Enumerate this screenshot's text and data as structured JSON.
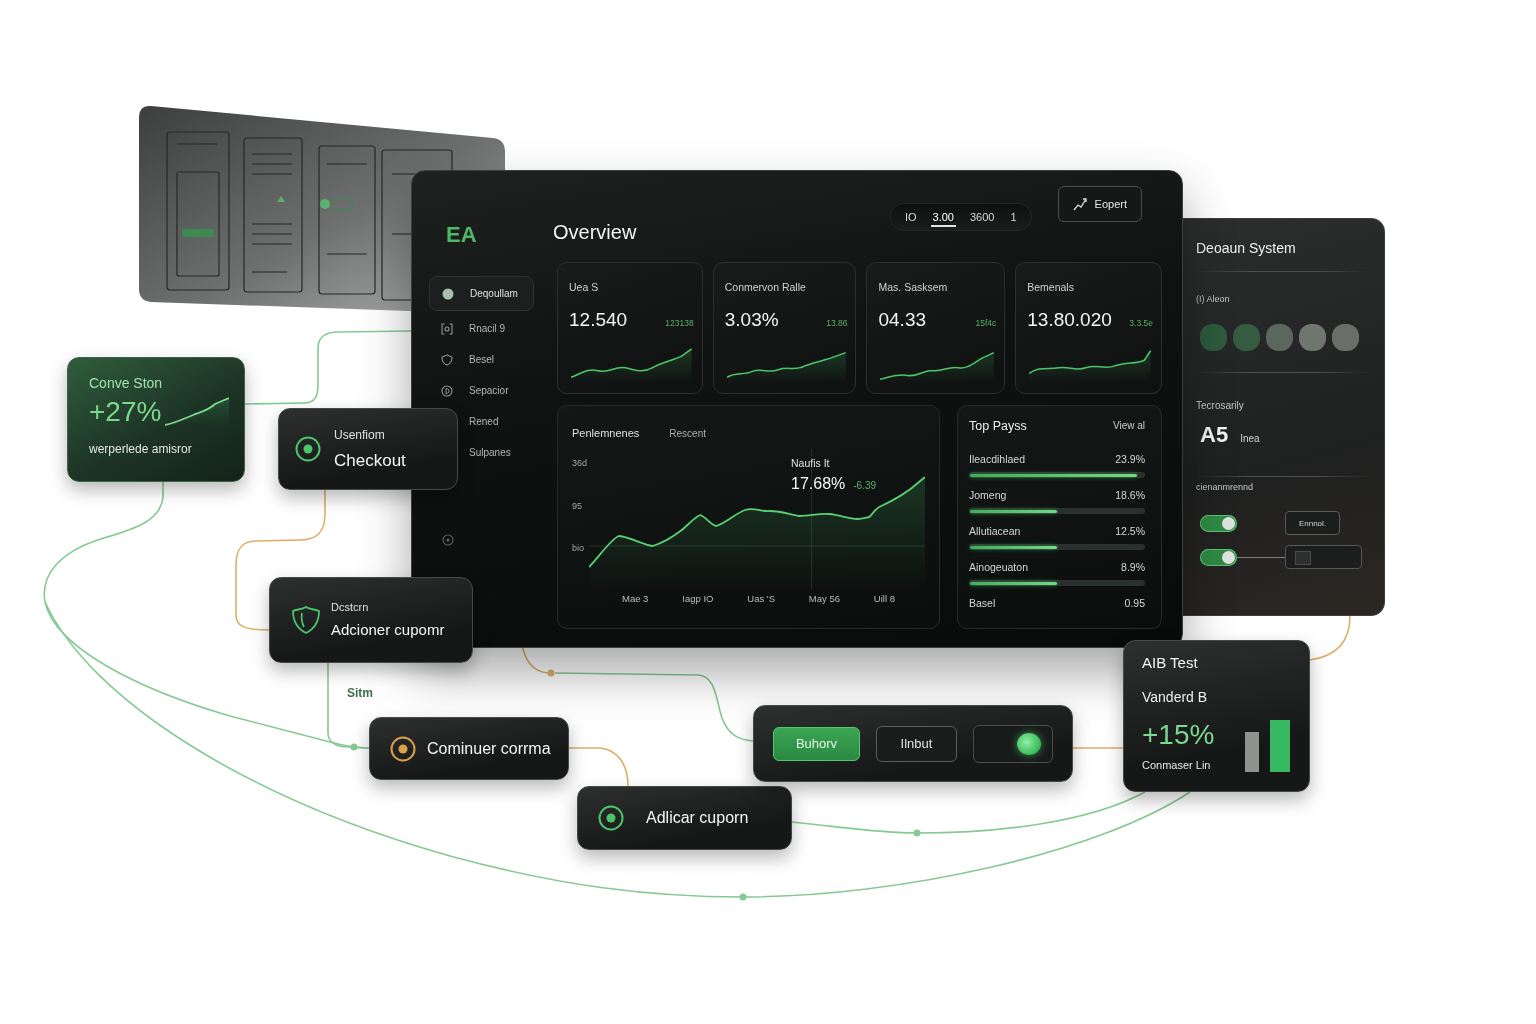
{
  "dashboard": {
    "logo": "EA",
    "title": "Overview",
    "range_tabs": [
      {
        "label": "IO",
        "selected": false
      },
      {
        "label": "3.00",
        "selected": true
      },
      {
        "label": "3600",
        "selected": false
      },
      {
        "label": "1",
        "selected": false
      }
    ],
    "export_button": "Eopert",
    "sidebar": {
      "items": [
        {
          "label": "Deqoullam",
          "selected": true
        },
        {
          "label": "Rnacil 9",
          "selected": false
        },
        {
          "label": "Besel",
          "selected": false
        },
        {
          "label": "Sepacior",
          "selected": false
        },
        {
          "label": "Rened",
          "selected": false
        },
        {
          "label": "Sulpanes",
          "selected": false
        }
      ]
    },
    "kpi_cards": [
      {
        "label": "Uea S",
        "value": "12.540",
        "change": "123138"
      },
      {
        "label": "Conmervon Ralle",
        "value": "3.03%",
        "change": "13.86"
      },
      {
        "label": "Mas. Sasksem",
        "value": "04.33",
        "change": "15f4c"
      },
      {
        "label": "Bemenals",
        "value": "13.80.020",
        "change": "3.3.5e"
      }
    ],
    "performance": {
      "title": "Penlemnenes",
      "tab": "Rescent",
      "y_labels": [
        "36d",
        "95",
        "bio"
      ],
      "tooltip": {
        "label": "Naufis It",
        "value": "17.68%",
        "change": "-6.39"
      },
      "x_labels": [
        "Mae 3",
        "Iagp IO",
        "Uas 'S",
        "May 56",
        "Uill 8"
      ]
    },
    "top_pages": {
      "title": "Top Payss",
      "link": "View al",
      "rows": [
        {
          "name": "Ileacdihlaed",
          "value": "23.9%",
          "level": 0.96
        },
        {
          "name": "Jomeng",
          "value": "18.6%",
          "level": 0.5
        },
        {
          "name": "Allutiacean",
          "value": "12.5%",
          "level": 0.5
        },
        {
          "name": "Ainogeuaton",
          "value": "8.9%",
          "level": 0.5
        },
        {
          "name": "Basel",
          "value": "0.95"
        }
      ]
    }
  },
  "side_panel": {
    "title": "Deoaun System",
    "palette_label": "(I) Aleon",
    "swatches": [
      {
        "color": "#2e5a3c"
      },
      {
        "color": "#355c41"
      },
      {
        "color": "#5b665e"
      },
      {
        "color": "#6f756f"
      },
      {
        "color": "#696e6a"
      }
    ],
    "stat_label": "Tecrosarily",
    "stat_value": "A5",
    "stat_unit": "Inea",
    "settings_label": "cienanmrennd",
    "settings": [
      {
        "kind": "button",
        "on": true,
        "button": "Ennnol."
      },
      {
        "kind": "field",
        "on": true
      }
    ]
  },
  "flow": {
    "nodes": [
      {
        "kind": "metric",
        "title": "Conve Ston",
        "value": "+27%",
        "caption": "werperlede amisror"
      },
      {
        "kind": "step",
        "color": "#4cc46a",
        "caption": "Usenfiom",
        "label": "Checkout"
      },
      {
        "kind": "offer",
        "color": "#4cc46a",
        "caption": "Dcstcrn",
        "label": "Adcioner cupomr"
      },
      {
        "kind": "step",
        "color": "#d9a24a",
        "label": "Cominuer corrma"
      },
      {
        "kind": "step",
        "color": "#4cc46a",
        "label": "Adlicar cuporn"
      },
      {
        "kind": "controls",
        "buttons": [
          {
            "label": "Buhorv",
            "primary": true
          },
          {
            "label": "Ilnbut",
            "primary": false
          }
        ],
        "toggle": {
          "on": true
        }
      },
      {
        "kind": "ab_test",
        "title": "AIB Test",
        "variant": "Vanderd B",
        "value": "+15%",
        "caption": "Conmaser Lin"
      }
    ],
    "edge_label": "Sitm"
  }
}
